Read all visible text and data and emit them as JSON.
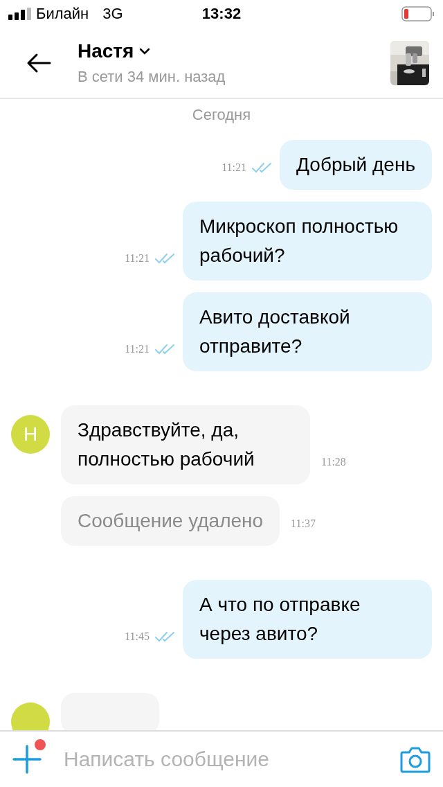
{
  "status_bar": {
    "carrier": "Билайн",
    "network": "3G",
    "time": "13:32"
  },
  "header": {
    "name": "Настя",
    "status": "В сети 34 мин. назад"
  },
  "date_label": "Сегодня",
  "messages": [
    {
      "outgoing": true,
      "kind": "text",
      "text": "Добрый день",
      "time": "11:21",
      "read": true
    },
    {
      "outgoing": true,
      "kind": "text",
      "text": "Микроскоп полностью рабочий?",
      "time": "11:21",
      "read": true
    },
    {
      "outgoing": true,
      "kind": "text",
      "text": "Авито доставкой отправите?",
      "time": "11:21",
      "read": true
    },
    {
      "outgoing": false,
      "kind": "text",
      "avatar": "Н",
      "text": "Здравствуйте, да, полностью рабочий",
      "time": "11:28"
    },
    {
      "outgoing": false,
      "kind": "deleted",
      "text": "Сообщение удалено",
      "time": "11:37"
    },
    {
      "outgoing": true,
      "kind": "text",
      "text": "А что по отправке через авито?",
      "time": "11:45",
      "read": true
    },
    {
      "outgoing": false,
      "kind": "partial"
    }
  ],
  "composer": {
    "placeholder": "Написать сообщение",
    "attach_badge": true
  }
}
